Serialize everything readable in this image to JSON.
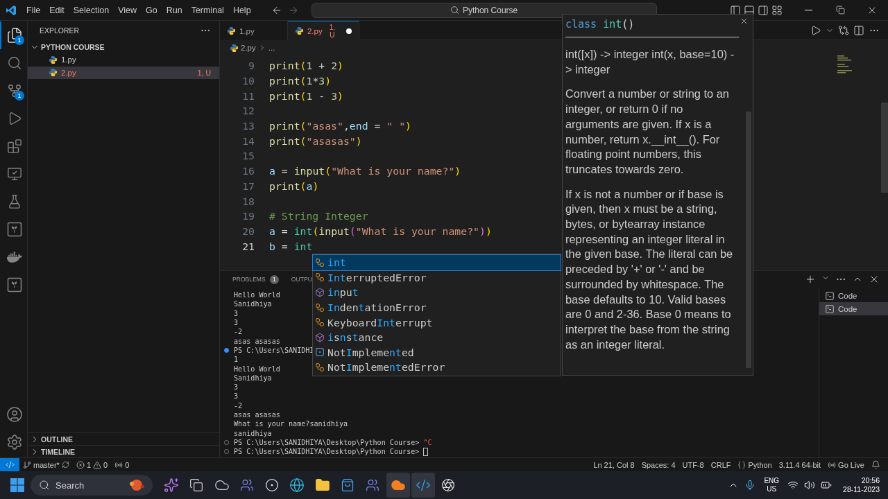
{
  "title_bar": {
    "menu": [
      "File",
      "Edit",
      "Selection",
      "View",
      "Go",
      "Run",
      "Terminal",
      "Help"
    ],
    "search": {
      "value": "Python Course"
    }
  },
  "activity_bar": {
    "items": [
      {
        "kind": "explorer",
        "selected": true,
        "badge": "1"
      },
      {
        "kind": "search",
        "selected": false
      },
      {
        "kind": "source-control",
        "selected": false,
        "badge": "1"
      },
      {
        "kind": "run",
        "selected": false
      },
      {
        "kind": "extensions",
        "selected": false
      },
      {
        "kind": "remote",
        "selected": false
      },
      {
        "kind": "testing",
        "selected": false
      },
      {
        "kind": "terraform-cloud",
        "selected": false
      },
      {
        "kind": "docker",
        "selected": false
      },
      {
        "kind": "terraform",
        "selected": false
      }
    ],
    "bottom": [
      {
        "kind": "accounts"
      },
      {
        "kind": "settings"
      }
    ]
  },
  "sidebar": {
    "title": "EXPLORER",
    "section": {
      "title": "PYTHON COURSE",
      "expanded": true,
      "files": [
        {
          "name": "1.py",
          "selected": false,
          "modified": false
        },
        {
          "name": "2.py",
          "selected": true,
          "modified": true,
          "status": "1, U"
        }
      ]
    },
    "collapsed_sections": [
      {
        "title": "OUTLINE",
        "expanded": false
      },
      {
        "title": "TIMELINE",
        "expanded": false
      }
    ]
  },
  "tabs": [
    {
      "label": "1.py",
      "selected": false,
      "modified": false,
      "dirty": false
    },
    {
      "label": "2.py",
      "selected": true,
      "modified": true,
      "status": "1, U",
      "dirty": true
    }
  ],
  "breadcrumbs": [
    "2.py",
    "..."
  ],
  "editor": {
    "lines": [
      {
        "number": "9",
        "current": false,
        "tokens": [
          {
            "kind": "fn",
            "text": "print"
          },
          {
            "kind": "bracket1",
            "text": "("
          },
          {
            "kind": "num",
            "text": "1"
          },
          {
            "kind": "op",
            "text": " + "
          },
          {
            "kind": "num",
            "text": "2"
          },
          {
            "kind": "bracket1",
            "text": ")"
          }
        ]
      },
      {
        "number": "10",
        "current": false,
        "tokens": [
          {
            "kind": "fn",
            "text": "print"
          },
          {
            "kind": "bracket1",
            "text": "("
          },
          {
            "kind": "num",
            "text": "1"
          },
          {
            "kind": "op",
            "text": "*"
          },
          {
            "kind": "num",
            "text": "3"
          },
          {
            "kind": "bracket1",
            "text": ")"
          }
        ]
      },
      {
        "number": "11",
        "current": false,
        "tokens": [
          {
            "kind": "fn",
            "text": "print"
          },
          {
            "kind": "bracket1",
            "text": "("
          },
          {
            "kind": "num",
            "text": "1"
          },
          {
            "kind": "op",
            "text": " - "
          },
          {
            "kind": "num",
            "text": "3"
          },
          {
            "kind": "bracket1",
            "text": ")"
          }
        ]
      },
      {
        "number": "12",
        "current": false
      },
      {
        "number": "13",
        "current": false,
        "tokens": [
          {
            "kind": "fn",
            "text": "print"
          },
          {
            "kind": "bracket1",
            "text": "("
          },
          {
            "kind": "str",
            "text": "\"asas\""
          },
          {
            "kind": "op",
            "text": ","
          },
          {
            "kind": "param",
            "text": "end"
          },
          {
            "kind": "op",
            "text": " = "
          },
          {
            "kind": "str",
            "text": "\" \""
          },
          {
            "kind": "bracket1",
            "text": ")"
          }
        ]
      },
      {
        "number": "14",
        "current": false,
        "tokens": [
          {
            "kind": "fn",
            "text": "print"
          },
          {
            "kind": "bracket1",
            "text": "("
          },
          {
            "kind": "str",
            "text": "\"asasas\""
          },
          {
            "kind": "bracket1",
            "text": ")"
          }
        ]
      },
      {
        "number": "15",
        "current": false
      },
      {
        "number": "16",
        "current": false,
        "tokens": [
          {
            "kind": "var",
            "text": "a"
          },
          {
            "kind": "op",
            "text": " = "
          },
          {
            "kind": "fn",
            "text": "input"
          },
          {
            "kind": "bracket1",
            "text": "("
          },
          {
            "kind": "str",
            "text": "\"What is your name?\""
          },
          {
            "kind": "bracket1",
            "text": ")"
          }
        ]
      },
      {
        "number": "17",
        "current": false,
        "tokens": [
          {
            "kind": "fn",
            "text": "print"
          },
          {
            "kind": "bracket1",
            "text": "("
          },
          {
            "kind": "var",
            "text": "a"
          },
          {
            "kind": "bracket1",
            "text": ")"
          }
        ]
      },
      {
        "number": "18",
        "current": false
      },
      {
        "number": "19",
        "current": false,
        "tokens": [
          {
            "kind": "comment",
            "text": "# String Integer"
          }
        ]
      },
      {
        "number": "20",
        "current": false,
        "tokens": [
          {
            "kind": "var",
            "text": "a"
          },
          {
            "kind": "op",
            "text": " = "
          },
          {
            "kind": "class",
            "text": "int"
          },
          {
            "kind": "bracket1",
            "text": "("
          },
          {
            "kind": "fn",
            "text": "input"
          },
          {
            "kind": "bracket2",
            "text": "("
          },
          {
            "kind": "str",
            "text": "\"What is your name?\""
          },
          {
            "kind": "bracket2",
            "text": ")"
          },
          {
            "kind": "bracket1",
            "text": ")"
          }
        ]
      },
      {
        "number": "21",
        "current": true,
        "tokens": [
          {
            "kind": "var",
            "text": "b"
          },
          {
            "kind": "op",
            "text": " = "
          },
          {
            "kind": "class",
            "text": "int"
          }
        ]
      }
    ]
  },
  "suggestions": [
    {
      "kind": "class",
      "label": "**int**",
      "selected": true
    },
    {
      "kind": "class",
      "label": "**Int**erruptedError",
      "selected": false
    },
    {
      "kind": "function",
      "label": "**in**pu**t**",
      "selected": false
    },
    {
      "kind": "class",
      "label": "**In**den**t**ationError",
      "selected": false
    },
    {
      "kind": "class",
      "label": "Keyboard**Int**errupt",
      "selected": false
    },
    {
      "kind": "function",
      "label": "**i**s**n**s**t**ance",
      "selected": false
    },
    {
      "kind": "constant",
      "label": "Not**I**mpleme**nt**ed",
      "selected": false
    },
    {
      "kind": "class",
      "label": "Not**I**mpleme**nt**edError",
      "selected": false
    }
  ],
  "hover": {
    "signature": [
      {
        "kind": "keyword",
        "text": "class"
      },
      {
        "kind": "class",
        "text": "int"
      },
      {
        "kind": "op",
        "text": "()"
      }
    ],
    "paragraphs": [
      "int([x]) -> integer int(x, base=10) -> integer",
      "Convert a number or string to an integer, or return 0 if no arguments are given. If x is a number, return x.__int__(). For floating point numbers, this truncates towards zero.",
      "If x is not a number or if base is given, then x must be a string, bytes, or bytearray instance representing an integer literal in the given base. The literal can be preceded by '+' or '-' and be surrounded by whitespace. The base defaults to 10. Valid bases are 0 and 2-36. Base 0 means to interpret the base from the string as an integer literal."
    ]
  },
  "panel": {
    "tabs": [
      {
        "label": "PROBLEMS",
        "badge": "1"
      },
      {
        "label": "OUTPU"
      }
    ],
    "terminal": [
      {
        "kind": "output",
        "text": "Hello World"
      },
      {
        "kind": "output",
        "text": "Sanidhiya"
      },
      {
        "kind": "output",
        "text": "3"
      },
      {
        "kind": "output",
        "text": "3"
      },
      {
        "kind": "output",
        "text": "-2"
      },
      {
        "kind": "output",
        "text": "asas asasas"
      },
      {
        "kind": "prompt-success",
        "text": "PS C:\\Users\\SANIDHI"
      },
      {
        "kind": "output",
        "text": "1"
      },
      {
        "kind": "output",
        "text": "Hello World"
      },
      {
        "kind": "output",
        "text": "Sanidhiya"
      },
      {
        "kind": "output",
        "text": "3"
      },
      {
        "kind": "output",
        "text": "3"
      },
      {
        "kind": "output",
        "text": "-2"
      },
      {
        "kind": "output",
        "text": "asas asasas"
      },
      {
        "kind": "output",
        "text": "What is your name?sanidhiya"
      },
      {
        "kind": "output",
        "text": "sanidhiya"
      },
      {
        "kind": "prompt-pending",
        "text": "PS C:\\Users\\SANIDHIYA\\Desktop\\Python Course>",
        "interrupt": "^C"
      },
      {
        "kind": "prompt-pending",
        "text": "PS C:\\Users\\SANIDHIYA\\Desktop\\Python Course>",
        "cursor": true
      }
    ],
    "terminals": [
      {
        "label": "Code",
        "selected": false
      },
      {
        "label": "Code",
        "selected": true
      }
    ]
  },
  "status_bar": {
    "branch": "master*",
    "errors": "1",
    "warnings": "0",
    "ports": "0",
    "right": [
      {
        "kind": "text",
        "text": "Ln 21, Col 8"
      },
      {
        "kind": "text",
        "text": "Spaces: 4"
      },
      {
        "kind": "text",
        "text": "UTF-8"
      },
      {
        "kind": "text",
        "text": "CRLF"
      },
      {
        "kind": "language",
        "text": "Python"
      },
      {
        "kind": "text",
        "text": "3.11.4 64-bit"
      },
      {
        "kind": "golive",
        "text": "Go Live"
      },
      {
        "kind": "bell"
      }
    ]
  },
  "taskbar": {
    "search": {
      "placeholder": "Search"
    },
    "apps": [
      {
        "kind": "copilot",
        "highlighted": false
      },
      {
        "kind": "task-view",
        "highlighted": false
      },
      {
        "kind": "weather",
        "highlighted": false
      },
      {
        "kind": "teams",
        "highlighted": false
      },
      {
        "kind": "steam",
        "highlighted": false
      },
      {
        "kind": "edge",
        "highlighted": false
      },
      {
        "kind": "files",
        "highlighted": false
      },
      {
        "kind": "store",
        "highlighted": false
      },
      {
        "kind": "teams",
        "highlighted": false
      },
      {
        "kind": "cloud",
        "highlighted": true
      },
      {
        "kind": "vscode",
        "highlighted": true
      },
      {
        "kind": "obs",
        "highlighted": false
      }
    ],
    "language": [
      "ENG",
      "US"
    ],
    "time": "20:56",
    "date": "28-11-2023"
  }
}
